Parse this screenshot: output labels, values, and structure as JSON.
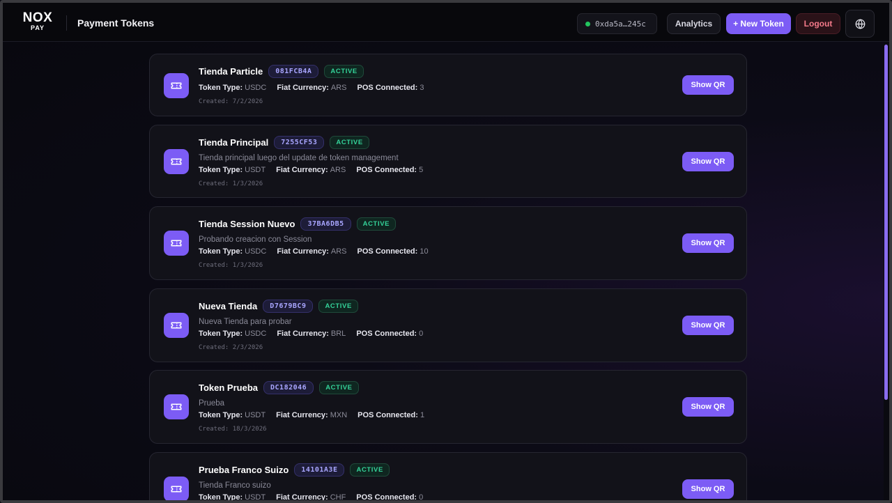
{
  "header": {
    "logo_main": "NOX",
    "logo_sub": "PAY",
    "title": "Payment Tokens",
    "wallet": "0xda5a…245c",
    "analytics_label": "Analytics",
    "new_token_label": "+ New Token",
    "logout_label": "Logout"
  },
  "labels": {
    "token_type": "Token Type:",
    "fiat_currency": "Fiat Currency:",
    "pos_connected": "POS Connected:",
    "show_qr": "Show QR"
  },
  "tokens": [
    {
      "name": "Tienda Particle",
      "code": "081FCB4A",
      "status": "ACTIVE",
      "description": "",
      "token_type": "USDC",
      "fiat": "ARS",
      "pos": "3",
      "created": "Created: 7/2/2026"
    },
    {
      "name": "Tienda Principal",
      "code": "7255CF53",
      "status": "ACTIVE",
      "description": "Tienda principal luego del update de token management",
      "token_type": "USDT",
      "fiat": "ARS",
      "pos": "5",
      "created": "Created: 1/3/2026"
    },
    {
      "name": "Tienda Session Nuevo",
      "code": "37BA6DB5",
      "status": "ACTIVE",
      "description": "Probando creacion con Session",
      "token_type": "USDC",
      "fiat": "ARS",
      "pos": "10",
      "created": "Created: 1/3/2026"
    },
    {
      "name": "Nueva Tienda",
      "code": "D7679BC9",
      "status": "ACTIVE",
      "description": "Nueva Tienda para probar",
      "token_type": "USDC",
      "fiat": "BRL",
      "pos": "0",
      "created": "Created: 2/3/2026"
    },
    {
      "name": "Token Prueba",
      "code": "DC182046",
      "status": "ACTIVE",
      "description": "Prueba",
      "token_type": "USDT",
      "fiat": "MXN",
      "pos": "1",
      "created": "Created: 18/3/2026"
    },
    {
      "name": "Prueba Franco Suizo",
      "code": "14101A3E",
      "status": "ACTIVE",
      "description": "Tienda Franco suizo",
      "token_type": "USDT",
      "fiat": "CHF",
      "pos": "0",
      "created": ""
    }
  ]
}
